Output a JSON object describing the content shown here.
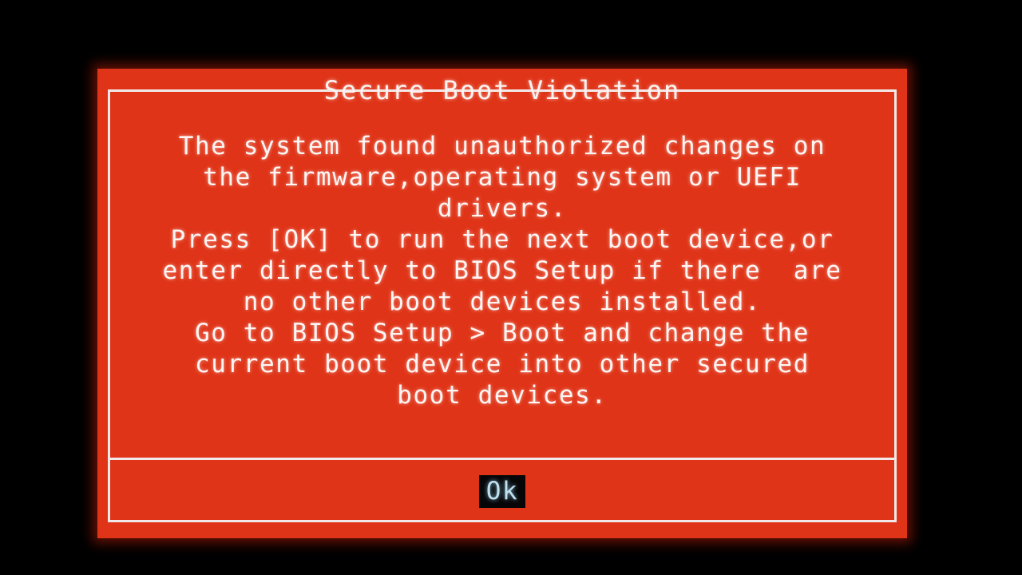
{
  "screen": {
    "background_color": "#000000",
    "panel_color": "#df3418",
    "frame_color": "#f2eaea",
    "text_color": "#fdf6f4"
  },
  "dialog": {
    "title": "Secure Boot Violation",
    "message_lines": [
      "The system found unauthorized changes on",
      "the firmware,operating system or UEFI",
      "drivers.",
      "Press [OK] to run the next boot device,or",
      "enter directly to BIOS Setup if there  are",
      "no other boot devices installed.",
      "Go to BIOS Setup > Boot and change the",
      "current boot device into other secured",
      "boot devices."
    ],
    "buttons": [
      {
        "label": "Ok",
        "selected": true,
        "background_color": "#060608",
        "text_color": "#bfe0ef"
      }
    ]
  }
}
